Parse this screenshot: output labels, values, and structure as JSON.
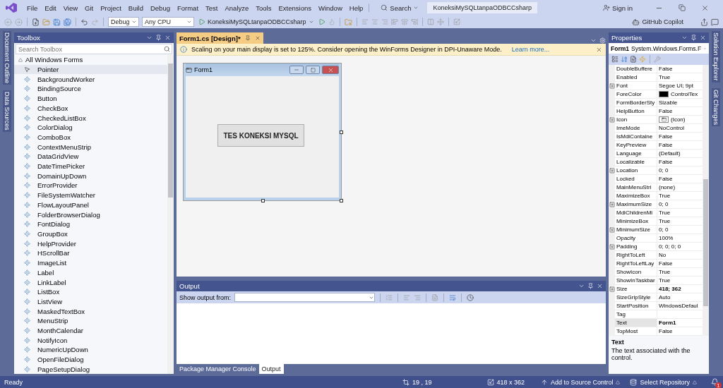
{
  "menu_bar": {
    "items": [
      "File",
      "Edit",
      "View",
      "Git",
      "Project",
      "Build",
      "Debug",
      "Format",
      "Test",
      "Analyze",
      "Tools",
      "Extensions",
      "Window",
      "Help"
    ],
    "search": "Search",
    "solution_name": "KoneksiMySQLtanpaODBCCsharp",
    "sign_in": "Sign in"
  },
  "toolbar": {
    "configuration": "Debug",
    "platform": "Any CPU",
    "start_target": "KoneksiMySQLtanpaODBCCsharp",
    "copilot": "GitHub Copilot"
  },
  "left_tabs": [
    "Document Outline",
    "Data Sources"
  ],
  "toolbox": {
    "title": "Toolbox",
    "search_placeholder": "Search Toolbox",
    "group": {
      "label": "All Windows Forms",
      "expanded": true
    },
    "items": [
      {
        "label": "Pointer",
        "selected": true
      },
      {
        "label": "BackgroundWorker",
        "selected": false
      },
      {
        "label": "BindingSource",
        "selected": false
      },
      {
        "label": "Button",
        "selected": false
      },
      {
        "label": "CheckBox",
        "selected": false
      },
      {
        "label": "CheckedListBox",
        "selected": false
      },
      {
        "label": "ColorDialog",
        "selected": false
      },
      {
        "label": "ComboBox",
        "selected": false
      },
      {
        "label": "ContextMenuStrip",
        "selected": false
      },
      {
        "label": "DataGridView",
        "selected": false
      },
      {
        "label": "DateTimePicker",
        "selected": false
      },
      {
        "label": "DomainUpDown",
        "selected": false
      },
      {
        "label": "ErrorProvider",
        "selected": false
      },
      {
        "label": "FileSystemWatcher",
        "selected": false
      },
      {
        "label": "FlowLayoutPanel",
        "selected": false
      },
      {
        "label": "FolderBrowserDialog",
        "selected": false
      },
      {
        "label": "FontDialog",
        "selected": false
      },
      {
        "label": "GroupBox",
        "selected": false
      },
      {
        "label": "HelpProvider",
        "selected": false
      },
      {
        "label": "HScrollBar",
        "selected": false
      },
      {
        "label": "ImageList",
        "selected": false
      },
      {
        "label": "Label",
        "selected": false
      },
      {
        "label": "LinkLabel",
        "selected": false
      },
      {
        "label": "ListBox",
        "selected": false
      },
      {
        "label": "ListView",
        "selected": false
      },
      {
        "label": "MaskedTextBox",
        "selected": false
      },
      {
        "label": "MenuStrip",
        "selected": false
      },
      {
        "label": "MonthCalendar",
        "selected": false
      },
      {
        "label": "NotifyIcon",
        "selected": false
      },
      {
        "label": "NumericUpDown",
        "selected": false
      },
      {
        "label": "OpenFileDialog",
        "selected": false
      },
      {
        "label": "PageSetupDialog",
        "selected": false
      }
    ]
  },
  "document_tab": {
    "title": "Form1.cs [Design]*"
  },
  "info_bar": {
    "message": "Scaling on your main display is set to 125%. Consider opening the WinForms Designer in DPI-Unaware Mode.",
    "link": "Learn more..."
  },
  "form": {
    "title": "Form1",
    "button": "TES KONEKSI MYSQL"
  },
  "output": {
    "title": "Output",
    "source_label": "Show output from:",
    "tabs": [
      {
        "label": "Package Manager Console",
        "selected": false
      },
      {
        "label": "Output",
        "selected": true
      }
    ]
  },
  "properties": {
    "title": "Properties",
    "object": "Form1",
    "object_type": "System.Windows.Forms.F",
    "rows": [
      {
        "name": "DoubleBuffere",
        "value": "False",
        "kind": "text",
        "expandable": false,
        "bold": false,
        "selected": false
      },
      {
        "name": "Enabled",
        "value": "True",
        "kind": "text",
        "expandable": false,
        "bold": false,
        "selected": false
      },
      {
        "name": "Font",
        "value": "Segoe UI; 9pt",
        "kind": "text",
        "expandable": true,
        "bold": false,
        "selected": false
      },
      {
        "name": "ForeColor",
        "value": "ControlTex",
        "kind": "color",
        "color": "#000000",
        "expandable": false,
        "bold": false,
        "selected": false
      },
      {
        "name": "FormBorderSty",
        "value": "Sizable",
        "kind": "text",
        "expandable": false,
        "bold": false,
        "selected": false
      },
      {
        "name": "HelpButton",
        "value": "False",
        "kind": "text",
        "expandable": false,
        "bold": false,
        "selected": false
      },
      {
        "name": "Icon",
        "value": "(Icon)",
        "kind": "icon",
        "expandable": true,
        "bold": false,
        "selected": false
      },
      {
        "name": "ImeMode",
        "value": "NoControl",
        "kind": "text",
        "expandable": false,
        "bold": false,
        "selected": false
      },
      {
        "name": "IsMdiContaine",
        "value": "False",
        "kind": "text",
        "expandable": false,
        "bold": false,
        "selected": false
      },
      {
        "name": "KeyPreview",
        "value": "False",
        "kind": "text",
        "expandable": false,
        "bold": false,
        "selected": false
      },
      {
        "name": "Language",
        "value": "(Default)",
        "kind": "text",
        "expandable": false,
        "bold": false,
        "selected": false
      },
      {
        "name": "Localizable",
        "value": "False",
        "kind": "text",
        "expandable": false,
        "bold": false,
        "selected": false
      },
      {
        "name": "Location",
        "value": "0; 0",
        "kind": "text",
        "expandable": true,
        "bold": false,
        "selected": false
      },
      {
        "name": "Locked",
        "value": "False",
        "kind": "text",
        "expandable": false,
        "bold": false,
        "selected": false
      },
      {
        "name": "MainMenuStri",
        "value": "(none)",
        "kind": "text",
        "expandable": false,
        "bold": false,
        "selected": false
      },
      {
        "name": "MaximizeBox",
        "value": "True",
        "kind": "text",
        "expandable": false,
        "bold": false,
        "selected": false
      },
      {
        "name": "MaximumSize",
        "value": "0; 0",
        "kind": "text",
        "expandable": true,
        "bold": false,
        "selected": false
      },
      {
        "name": "MdiChildrenMi",
        "value": "True",
        "kind": "text",
        "expandable": false,
        "bold": false,
        "selected": false
      },
      {
        "name": "MinimizeBox",
        "value": "True",
        "kind": "text",
        "expandable": false,
        "bold": false,
        "selected": false
      },
      {
        "name": "MinimumSize",
        "value": "0; 0",
        "kind": "text",
        "expandable": true,
        "bold": false,
        "selected": false
      },
      {
        "name": "Opacity",
        "value": "100%",
        "kind": "text",
        "expandable": false,
        "bold": false,
        "selected": false
      },
      {
        "name": "Padding",
        "value": "0; 0; 0; 0",
        "kind": "text",
        "expandable": true,
        "bold": false,
        "selected": false
      },
      {
        "name": "RightToLeft",
        "value": "No",
        "kind": "text",
        "expandable": false,
        "bold": false,
        "selected": false
      },
      {
        "name": "RightToLeftLay",
        "value": "False",
        "kind": "text",
        "expandable": false,
        "bold": false,
        "selected": false
      },
      {
        "name": "ShowIcon",
        "value": "True",
        "kind": "text",
        "expandable": false,
        "bold": false,
        "selected": false
      },
      {
        "name": "ShowInTaskbar",
        "value": "True",
        "kind": "text",
        "expandable": false,
        "bold": false,
        "selected": false
      },
      {
        "name": "Size",
        "value": "418; 362",
        "kind": "text",
        "expandable": true,
        "bold": true,
        "selected": false
      },
      {
        "name": "SizeGripStyle",
        "value": "Auto",
        "kind": "text",
        "expandable": false,
        "bold": false,
        "selected": false
      },
      {
        "name": "StartPosition",
        "value": "WindowsDefaul",
        "kind": "text",
        "expandable": false,
        "bold": false,
        "selected": false
      },
      {
        "name": "Tag",
        "expandable": false,
        "selected": false
      },
      {
        "name": "Text",
        "value": "Form1",
        "kind": "text",
        "expandable": false,
        "bold": true,
        "selected": true
      },
      {
        "name": "TopMost",
        "value": "False",
        "kind": "text",
        "expandable": false,
        "bold": false,
        "selected": false
      }
    ],
    "description": {
      "title": "Text",
      "text": "The text associated with the control."
    }
  },
  "right_tabs": [
    "Solution Explorer",
    "Git Changes"
  ],
  "status_bar": {
    "message": "Ready",
    "position": "19 , 19",
    "size": "418 x 362",
    "source_control": "Add to Source Control",
    "repository": "Select Repository",
    "notifications": "1"
  }
}
